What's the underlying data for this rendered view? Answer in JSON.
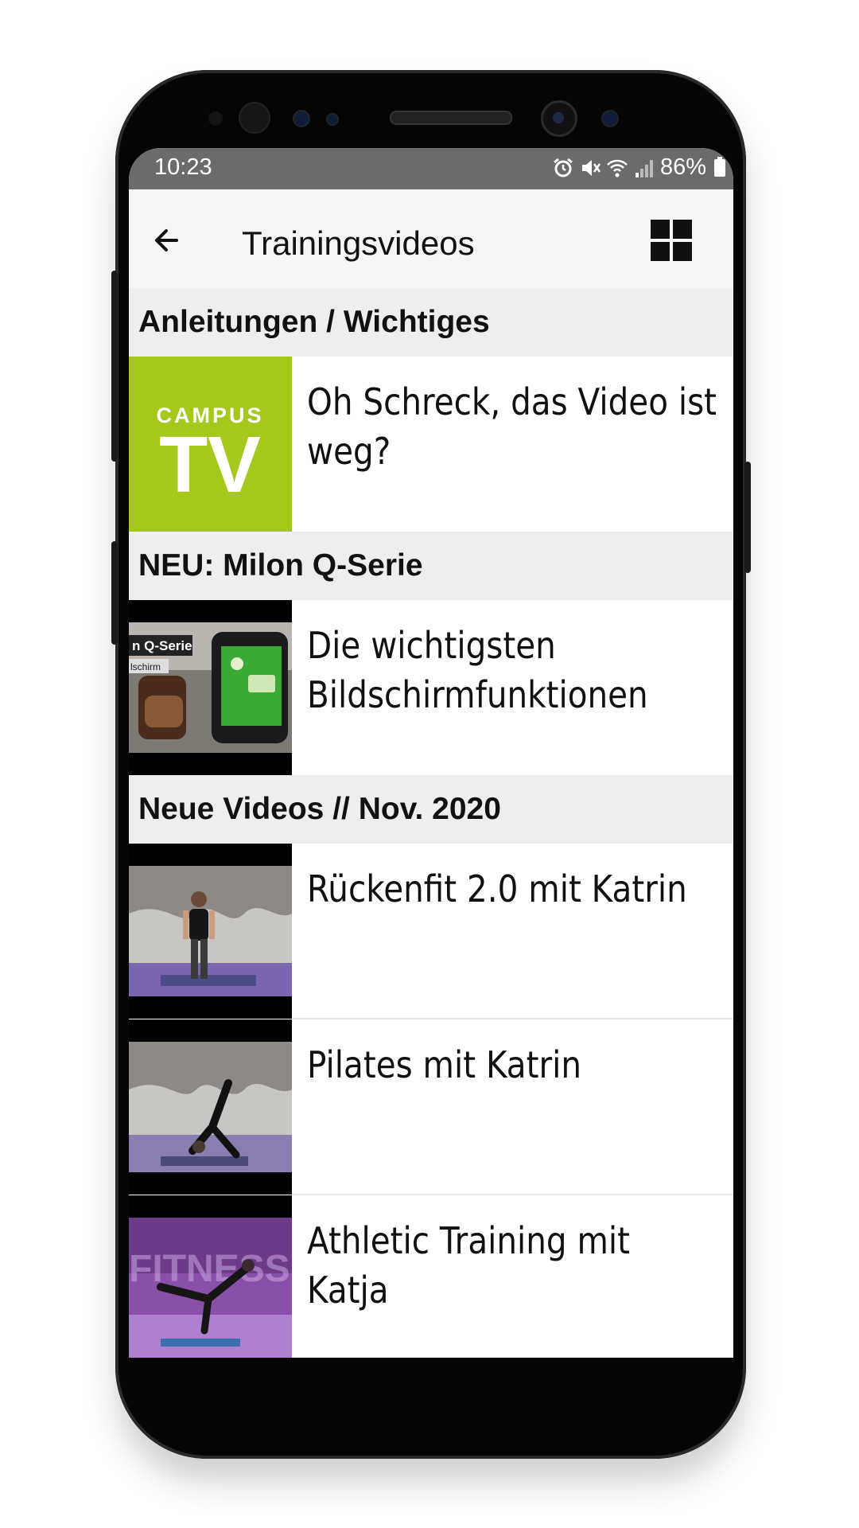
{
  "status_bar": {
    "time": "10:23",
    "battery_percent": "86%",
    "icons": [
      "alarm-icon",
      "mute-icon",
      "wifi-icon",
      "signal-icon",
      "battery-icon"
    ]
  },
  "app_bar": {
    "title": "Trainingsvideos",
    "back_icon": "arrow-left-icon",
    "view_toggle_icon": "grid-view-icon"
  },
  "sections": [
    {
      "title": "Anleitungen / Wichtiges",
      "items": [
        {
          "title_line1": "Oh Schreck, das Video ist",
          "title_line2": "weg?",
          "thumb_text_small": "CAMPUS",
          "thumb_text_large": "TV",
          "thumb_color": "#a4c81c"
        }
      ]
    },
    {
      "title": "NEU: Milon Q-Serie",
      "items": [
        {
          "title_line1": "Die wichtigsten",
          "title_line2": "Bildschirmfunktionen",
          "thumb_label1": "n Q-Serie",
          "thumb_label2": "lschirm"
        }
      ]
    },
    {
      "title": "Neue Videos // Nov. 2020",
      "items": [
        {
          "title_line1": "Rückenfit 2.0 mit Katrin",
          "title_line2": ""
        },
        {
          "title_line1": "Pilates mit Katrin",
          "title_line2": ""
        },
        {
          "title_line1": "Athletic Training mit",
          "title_line2": "Katja",
          "thumb_watermark": "FITNESS"
        }
      ]
    }
  ],
  "colors": {
    "status_bar": "#6b6b6b",
    "app_bar": "#f5f5f5",
    "section_header": "#eeeeee",
    "campus_green": "#a4c81c"
  }
}
